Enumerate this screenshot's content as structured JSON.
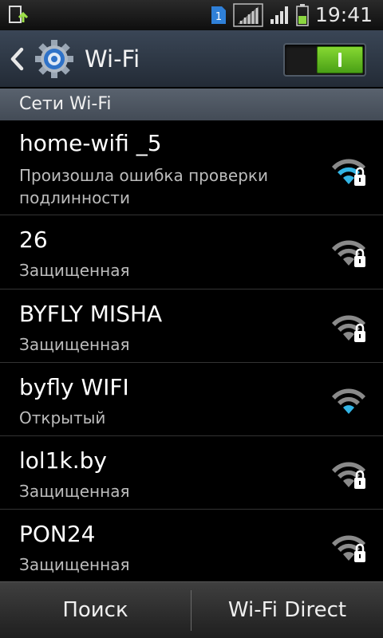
{
  "statusbar": {
    "sim_slot": "1",
    "time": "19:41"
  },
  "actionbar": {
    "title": "Wi-Fi",
    "wifi_enabled": true
  },
  "section": {
    "header": "Сети Wi-Fi"
  },
  "networks": [
    {
      "name": "home-wifi _5",
      "status": "Произошла ошибка проверки подлинности",
      "secured": true,
      "signal_color": "#33b5e5"
    },
    {
      "name": "26",
      "status": "Защищенная",
      "secured": true,
      "signal_color": "#8a8a8a"
    },
    {
      "name": "BYFLY MISHA",
      "status": "Защищенная",
      "secured": true,
      "signal_color": "#8a8a8a"
    },
    {
      "name": "byfly WIFI",
      "status": "Открытый",
      "secured": false,
      "signal_color": "#33b5e5"
    },
    {
      "name": "lol1k.by",
      "status": "Защищенная",
      "secured": true,
      "signal_color": "#8a8a8a"
    },
    {
      "name": "PON24",
      "status": "Защищенная",
      "secured": true,
      "signal_color": "#8a8a8a"
    }
  ],
  "bottombar": {
    "search_label": "Поиск",
    "wifi_direct_label": "Wi-Fi Direct"
  },
  "colors": {
    "accent_blue": "#33b5e5",
    "toggle_green": "#6cc024"
  }
}
